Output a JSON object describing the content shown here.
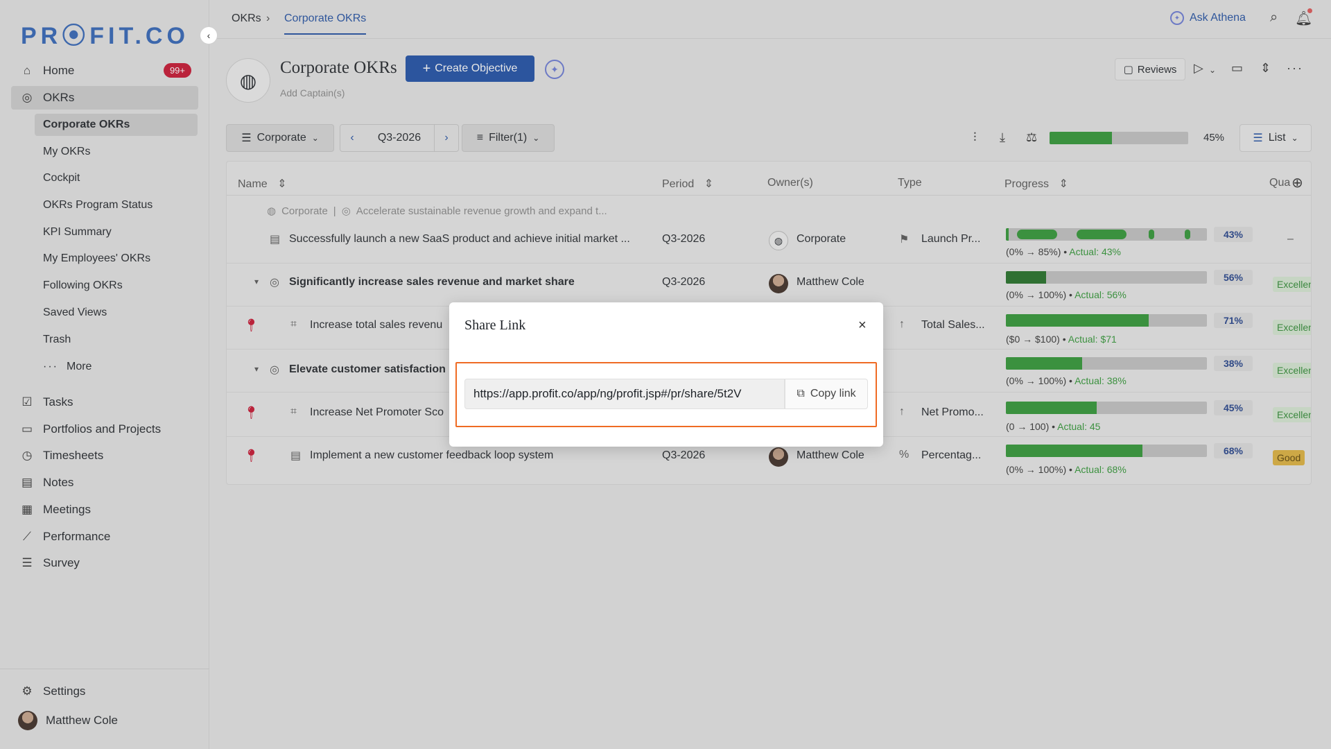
{
  "app": {
    "logo": "PR⦿FIT.CO"
  },
  "sidebar": {
    "home": {
      "label": "Home",
      "badge": "99+"
    },
    "okrs": {
      "label": "OKRs"
    },
    "sub_items": [
      "Corporate OKRs",
      "My OKRs",
      "Cockpit",
      "OKRs Program Status",
      "KPI Summary",
      "My Employees' OKRs",
      "Following OKRs",
      "Saved Views",
      "Trash",
      "More"
    ],
    "items": [
      "Tasks",
      "Portfolios and Projects",
      "Timesheets",
      "Notes",
      "Meetings",
      "Performance",
      "Survey"
    ],
    "settings": "Settings",
    "user": "Matthew Cole"
  },
  "topbar": {
    "crumb_root": "OKRs",
    "crumb_active": "Corporate OKRs",
    "ask": "Ask Athena"
  },
  "header": {
    "title": "Corporate OKRs",
    "create_label": "Create Objective",
    "add_captain": "Add Captain(s)",
    "reviews": "Reviews"
  },
  "toolbar": {
    "scope": "Corporate",
    "period": "Q3-2026",
    "filter": "Filter(1)",
    "overall_progress": 45,
    "overall_pct": "45%",
    "view": "List"
  },
  "table": {
    "headers": {
      "name": "Name",
      "period": "Period",
      "owners": "Owner(s)",
      "type": "Type",
      "progress": "Progress",
      "quality": "Qua"
    },
    "context": {
      "scope": "Corporate",
      "sep": "|",
      "objective": "Accelerate sustainable revenue growth and expand t..."
    },
    "rows": [
      {
        "name": "Successfully launch a new SaaS product and achieve initial market ...",
        "period": "Q3-2026",
        "owner": "Corporate",
        "type": "Launch Pr...",
        "progress": 43,
        "pct": "43%",
        "range": "(0% → 85%) •",
        "actual": "Actual: 43%",
        "quality": "–"
      },
      {
        "name": "Significantly increase sales revenue and market share",
        "period": "Q3-2026",
        "owner": "Matthew Cole",
        "type": "",
        "progress": 20,
        "pct": "56%",
        "range": "(0% → 100%) •",
        "actual": "Actual: 56%",
        "quality": "Excellent"
      },
      {
        "name": "Increase total sales revenu",
        "period": "",
        "owner": "",
        "type": "Total Sales...",
        "progress": 71,
        "pct": "71%",
        "range": "($0 → $100) •",
        "actual": "Actual: $71",
        "quality": "Excellent"
      },
      {
        "name": "Elevate customer satisfaction",
        "period": "",
        "owner": "",
        "type": "",
        "progress": 38,
        "pct": "38%",
        "range": "(0% → 100%) •",
        "actual": "Actual: 38%",
        "quality": "Excellent"
      },
      {
        "name": "Increase Net Promoter Sco",
        "period": "",
        "owner": "",
        "type": "Net Promo...",
        "progress": 45,
        "pct": "45%",
        "range": "(0 → 100) •",
        "actual": "Actual: 45",
        "quality": "Excellent"
      },
      {
        "name": "Implement a new customer feedback loop system",
        "period": "Q3-2026",
        "owner": "Matthew Cole",
        "type": "Percentag...",
        "progress": 68,
        "pct": "68%",
        "range": "(0% → 100%) •",
        "actual": "Actual: 68%",
        "quality": "Good"
      }
    ]
  },
  "modal": {
    "title": "Share Link",
    "url": "https://app.profit.co/app/ng/profit.jsp#/pr/share/5t2V",
    "copy_label": "Copy link"
  },
  "colors": {
    "brand": "#1c4ea6",
    "progress": "#2e9632",
    "highlight": "#ef6b23",
    "badge": "#c8102e"
  }
}
